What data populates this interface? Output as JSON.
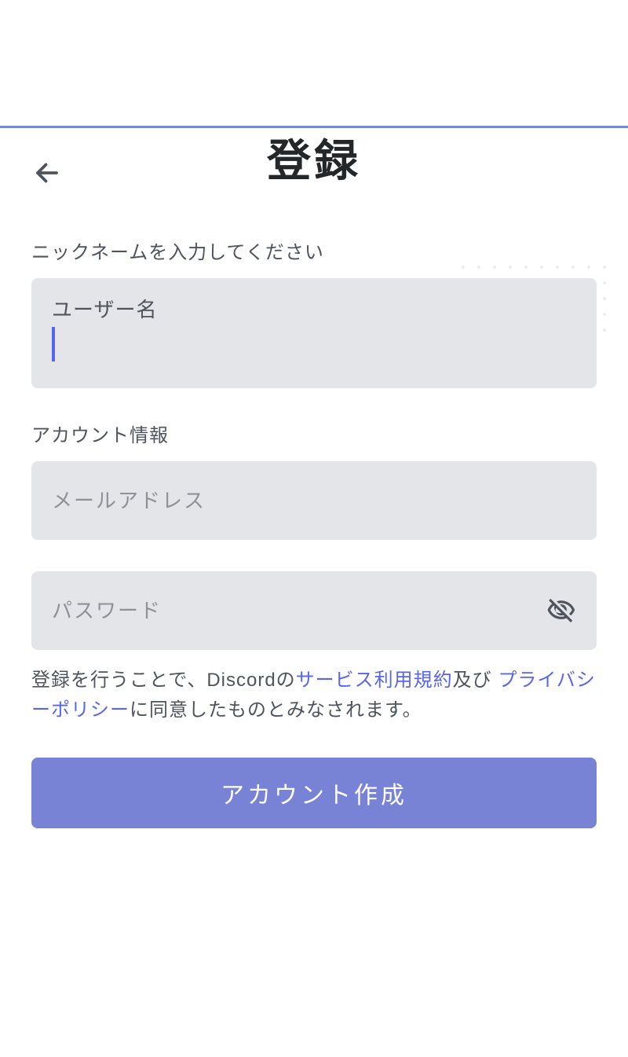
{
  "page": {
    "title": "登録"
  },
  "form": {
    "nickname_section_label": "ニックネームを入力してください",
    "username_label": "ユーザー名",
    "username_value": "",
    "account_section_label": "アカウント情報",
    "email_placeholder": "メールアドレス",
    "email_value": "",
    "password_placeholder": "パスワード",
    "password_value": ""
  },
  "legal": {
    "prefix": "登録を行うことで、Discordの",
    "tos_link": "サービス利用規約",
    "and_text": "及び ",
    "privacy_link": "プライバシーポリシー",
    "suffix": "に同意したものとみなされます。"
  },
  "button": {
    "submit_label": "アカウント作成"
  }
}
